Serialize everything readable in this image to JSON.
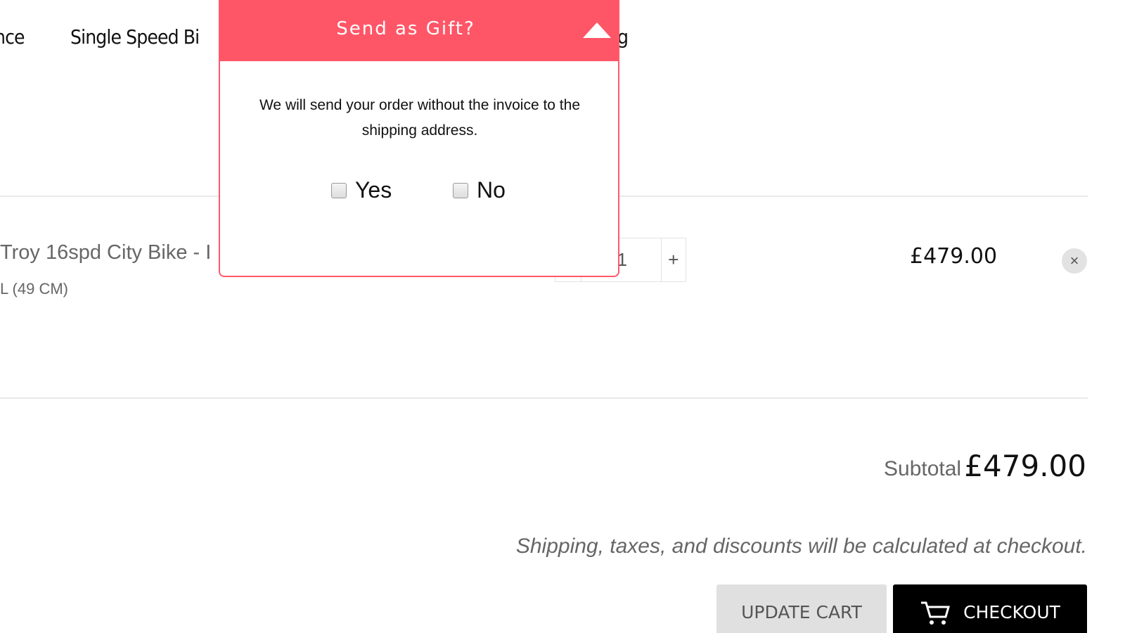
{
  "nav": {
    "items": [
      "nce",
      "Single Speed Bi",
      "g"
    ]
  },
  "cart": {
    "item": {
      "name": "Troy 16spd City Bike - I",
      "variant": "L (49 CM)",
      "quantity": "1",
      "minus": "−",
      "plus": "+",
      "price": "£479.00",
      "remove": "×"
    },
    "subtotal_label": "Subtotal",
    "subtotal_value": "£479.00",
    "note": "Shipping, taxes, and discounts will be calculated at checkout.",
    "update_label": "UPDATE CART",
    "checkout_label": "CHECKOUT"
  },
  "gift_modal": {
    "title": "Send as Gift?",
    "text": "We will send your order without the invoice to the shipping address.",
    "yes": "Yes",
    "no": "No",
    "accent": "#ff5667"
  }
}
